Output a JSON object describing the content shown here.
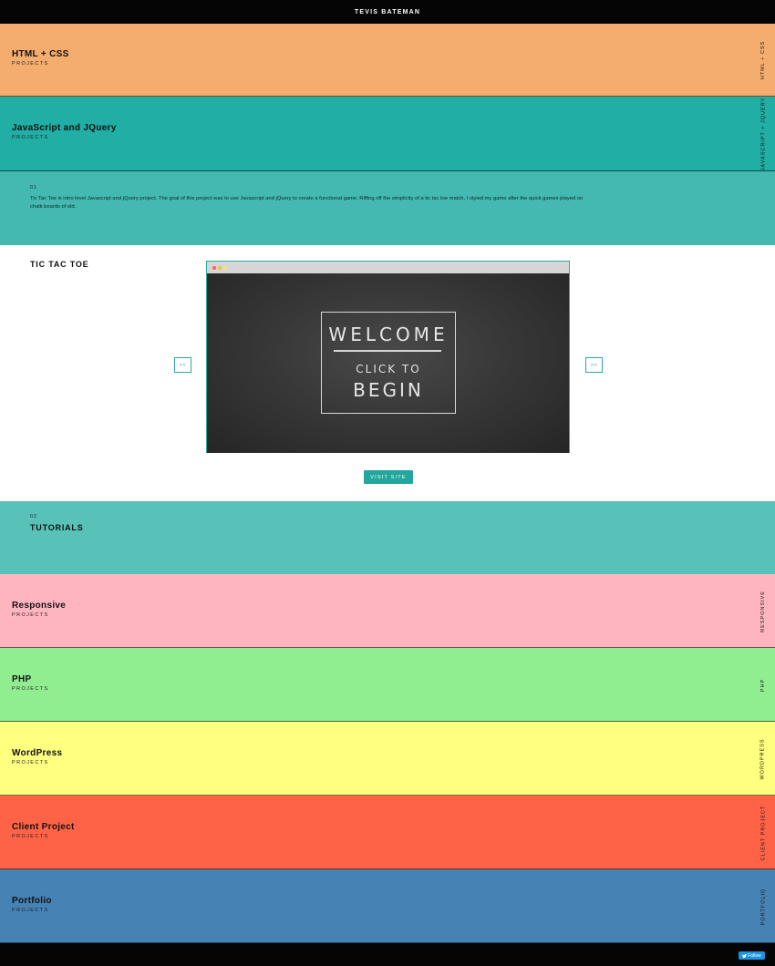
{
  "header": {
    "site_name": "TEVIS BATEMAN"
  },
  "sections_top": [
    {
      "title": "HTML + CSS",
      "subtitle": "PROJECTS",
      "side_label": "HTML + CSS",
      "color": "#f4ad6f"
    },
    {
      "title": "JavaScript and JQuery",
      "subtitle": "PROJECTS",
      "side_label": "JAVASCRIPT + JQUERY",
      "color": "#20aea5"
    }
  ],
  "project": {
    "number": "01",
    "description": "Tic Tac Toe is intro level Javascript and jQuery project. The goal of this project was to use Javascript and jQuery to create a functional game. Riffing off the simplicity of a tic tac toe match, I styled my game after the quick games played on chalk boards of old.",
    "title": "TIC TAC TOE",
    "prev_label": "<<",
    "next_label": ">>",
    "visit_label": "VISIT SITE",
    "screenshot": {
      "welcome": "WELCOME",
      "click": "CLICK TO",
      "begin": "BEGIN"
    }
  },
  "tutorials": {
    "number": "02",
    "title": "TUTORIALS"
  },
  "sections_bottom": [
    {
      "title": "Responsive",
      "subtitle": "PROJECTS",
      "side_label": "RESPONSIVE",
      "color": "#ffb5c0"
    },
    {
      "title": "PHP",
      "subtitle": "PROJECTS",
      "side_label": "PHP",
      "color": "#90ee90"
    },
    {
      "title": "WordPress",
      "subtitle": "PROJECTS",
      "side_label": "WORDPRESS",
      "color": "#ffff80"
    },
    {
      "title": "Client Project",
      "subtitle": "PROJECTS",
      "side_label": "CLIENT PROJECT",
      "color": "#ff6347"
    },
    {
      "title": "Portfolio",
      "subtitle": "PROJECTS",
      "side_label": "PORTFOLIO",
      "color": "#4682b4"
    }
  ],
  "footer": {
    "follow_label": "Follow",
    "follow_icon": "twitter-bird-icon"
  }
}
